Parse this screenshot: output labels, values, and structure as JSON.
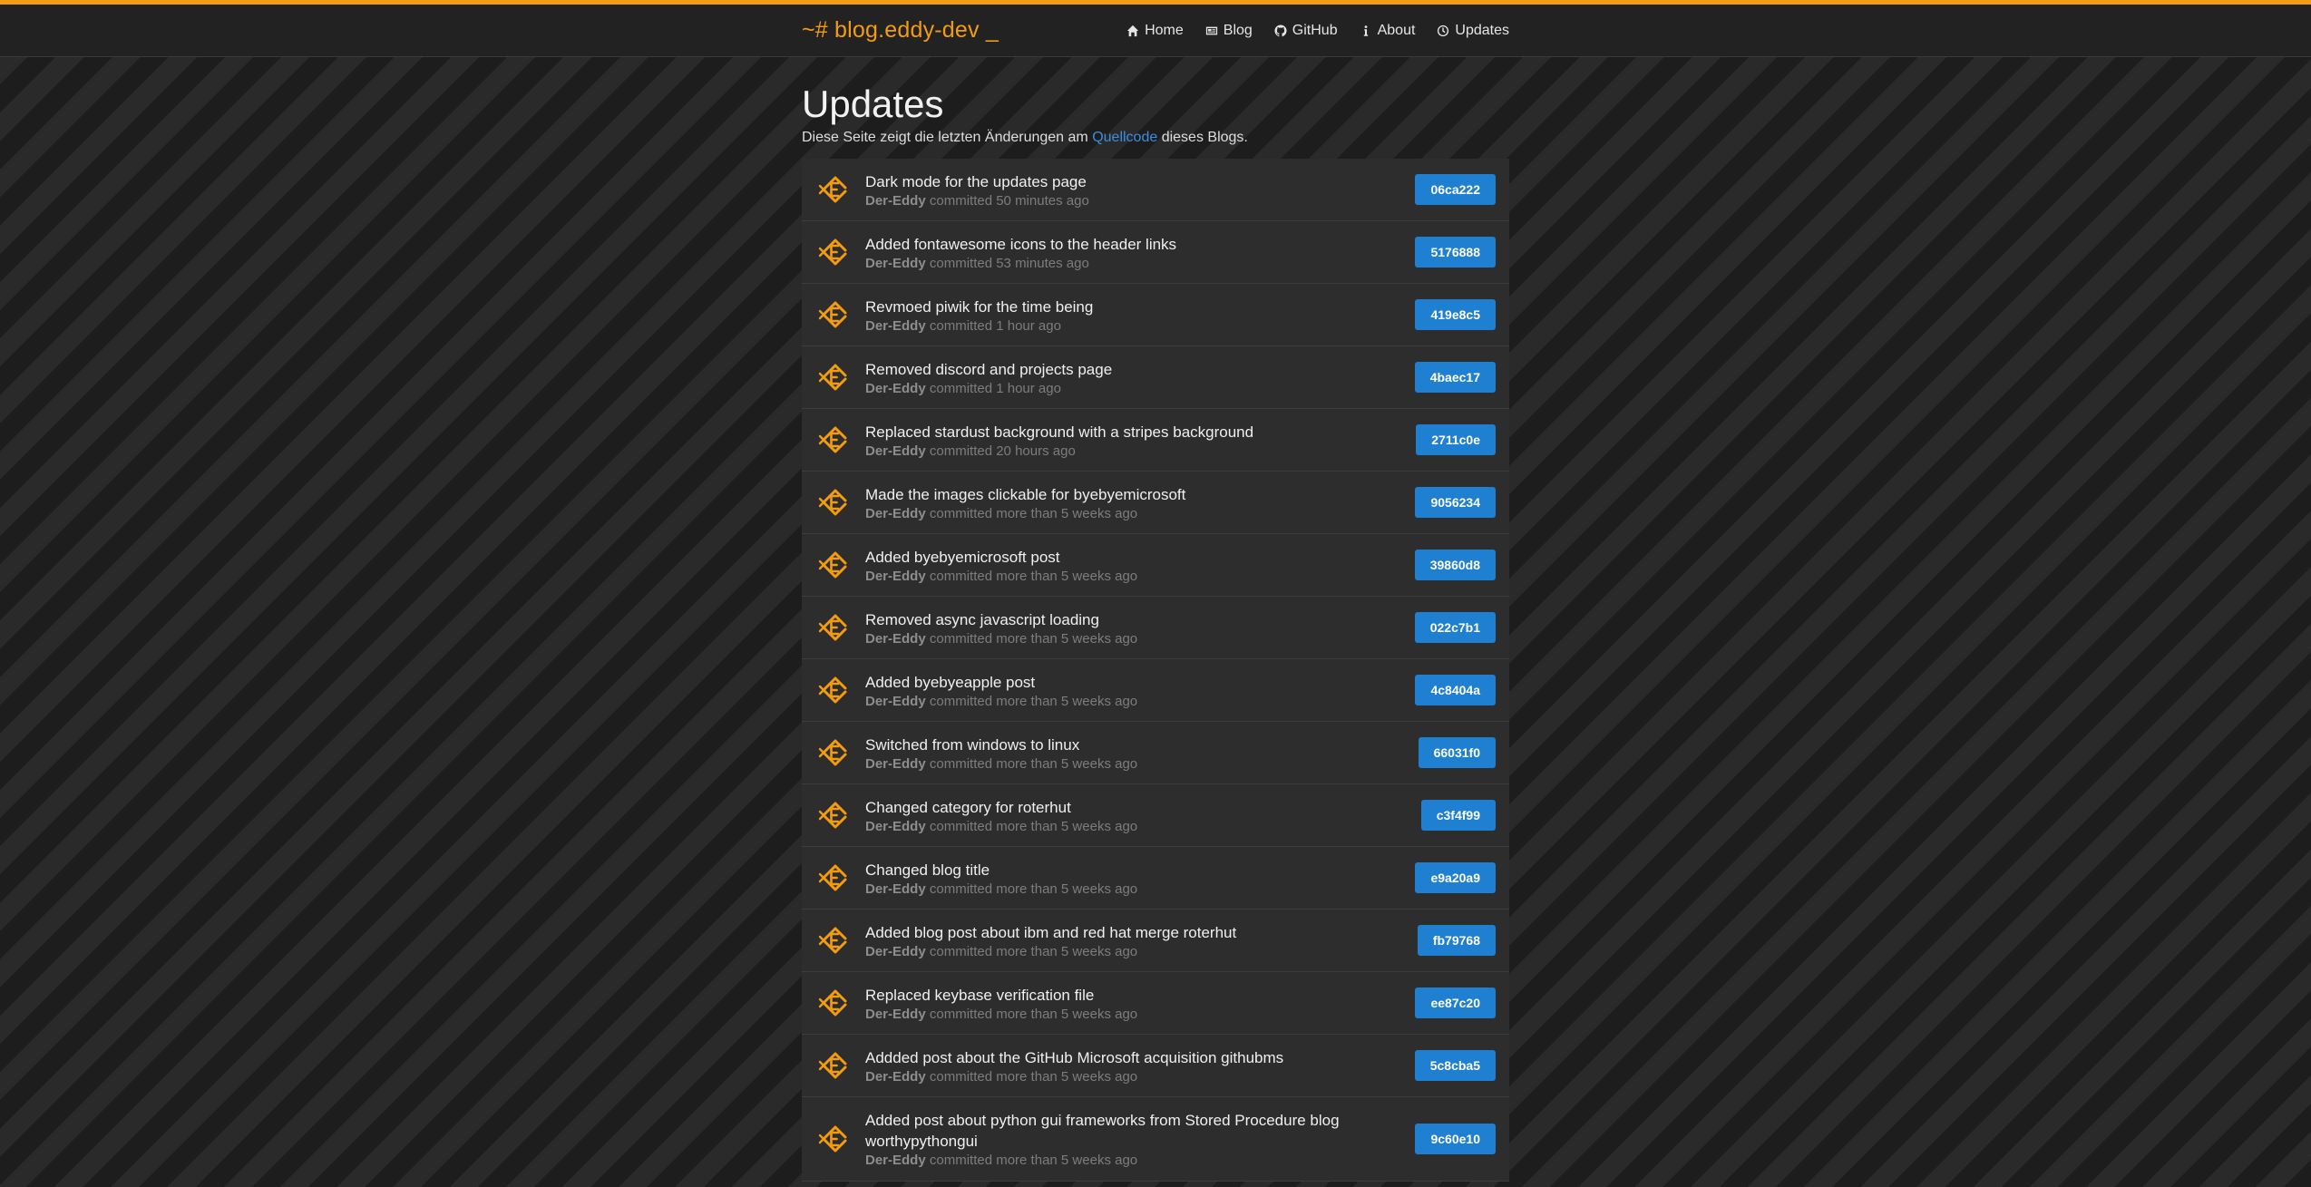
{
  "header": {
    "brand": "~# blog.eddy-dev _",
    "nav": [
      {
        "label": "Home",
        "icon": "home-icon"
      },
      {
        "label": "Blog",
        "icon": "newspaper-icon"
      },
      {
        "label": "GitHub",
        "icon": "github-icon"
      },
      {
        "label": "About",
        "icon": "info-icon"
      },
      {
        "label": "Updates",
        "icon": "clock-icon"
      }
    ]
  },
  "colors": {
    "accent": "#f39c12",
    "sha_button": "#1f7fd1",
    "link": "#3b8ee0"
  },
  "page": {
    "title": "Updates",
    "intro_before": "Diese Seite zeigt die letzten Änderungen am ",
    "intro_link": "Quellcode",
    "intro_after": " dieses Blogs."
  },
  "commits": [
    {
      "message": "Dark mode for the updates page",
      "author": "Der-Eddy",
      "time": "committed 50 minutes ago",
      "sha": "06ca222"
    },
    {
      "message": "Added fontawesome icons to the header links",
      "author": "Der-Eddy",
      "time": "committed 53 minutes ago",
      "sha": "5176888"
    },
    {
      "message": "Revmoed piwik for the time being",
      "author": "Der-Eddy",
      "time": "committed 1 hour ago",
      "sha": "419e8c5"
    },
    {
      "message": "Removed discord and projects page",
      "author": "Der-Eddy",
      "time": "committed 1 hour ago",
      "sha": "4baec17"
    },
    {
      "message": "Replaced stardust background with a stripes background",
      "author": "Der-Eddy",
      "time": "committed 20 hours ago",
      "sha": "2711c0e"
    },
    {
      "message": "Made the images clickable for byebyemicrosoft",
      "author": "Der-Eddy",
      "time": "committed more than 5 weeks ago",
      "sha": "9056234"
    },
    {
      "message": "Added byebyemicrosoft post",
      "author": "Der-Eddy",
      "time": "committed more than 5 weeks ago",
      "sha": "39860d8"
    },
    {
      "message": "Removed async javascript loading",
      "author": "Der-Eddy",
      "time": "committed more than 5 weeks ago",
      "sha": "022c7b1"
    },
    {
      "message": "Added byebyeapple post",
      "author": "Der-Eddy",
      "time": "committed more than 5 weeks ago",
      "sha": "4c8404a"
    },
    {
      "message": "Switched from windows to linux",
      "author": "Der-Eddy",
      "time": "committed more than 5 weeks ago",
      "sha": "66031f0"
    },
    {
      "message": "Changed category for roterhut",
      "author": "Der-Eddy",
      "time": "committed more than 5 weeks ago",
      "sha": "c3f4f99"
    },
    {
      "message": "Changed blog title",
      "author": "Der-Eddy",
      "time": "committed more than 5 weeks ago",
      "sha": "e9a20a9"
    },
    {
      "message": "Added blog post about ibm and red hat merge roterhut",
      "author": "Der-Eddy",
      "time": "committed more than 5 weeks ago",
      "sha": "fb79768"
    },
    {
      "message": "Replaced keybase verification file",
      "author": "Der-Eddy",
      "time": "committed more than 5 weeks ago",
      "sha": "ee87c20"
    },
    {
      "message": "Addded post about the GitHub Microsoft acquisition githubms",
      "author": "Der-Eddy",
      "time": "committed more than 5 weeks ago",
      "sha": "5c8cba5"
    },
    {
      "message": "Added post about python gui frameworks from Stored Procedure blog worthypythongui",
      "author": "Der-Eddy",
      "time": "committed more than 5 weeks ago",
      "sha": "9c60e10"
    }
  ]
}
